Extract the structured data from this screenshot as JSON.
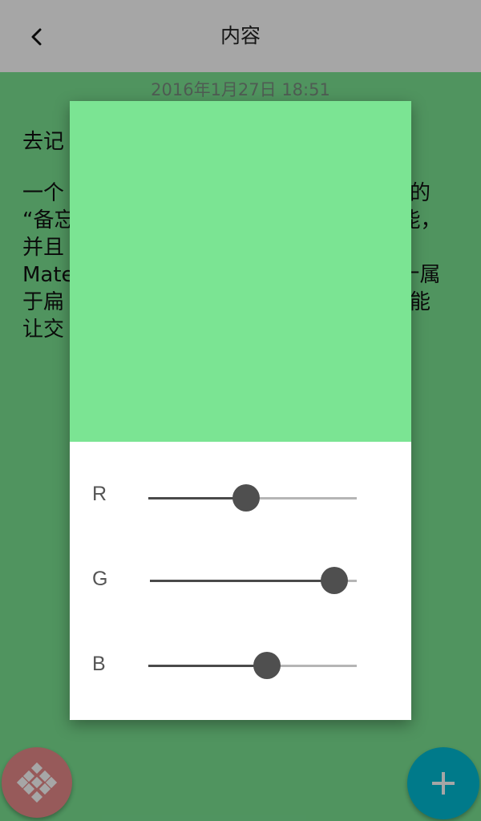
{
  "toolbar": {
    "title": "内容",
    "back_icon": "chevron-left-icon"
  },
  "note": {
    "timestamp": "2016年1月27日 18:51",
    "title": "去记",
    "body": "一个                                                 得的\n“备忘                                                 能，\n并且\nMate                                                 十属\n于扁                                                 ，能\n让交"
  },
  "dialog": {
    "preview_color": "#7be493",
    "sliders": [
      {
        "label": "R",
        "value": 0.47
      },
      {
        "label": "G",
        "value": 0.89
      },
      {
        "label": "B",
        "value": 0.57
      }
    ]
  },
  "fabs": {
    "left_icon": "grid-dots-icon",
    "left_color": "#e98a8a",
    "right_icon": "plus-icon",
    "right_color": "#00bcd4"
  }
}
